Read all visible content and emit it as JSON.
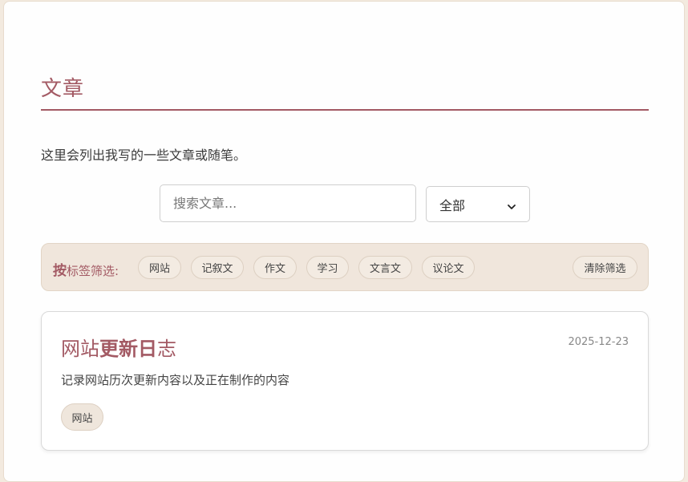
{
  "page": {
    "title": "文章",
    "intro": "这里会列出我写的一些文章或随笔。"
  },
  "search": {
    "placeholder": "搜索文章...",
    "value": ""
  },
  "filter_select": {
    "selected": "全部",
    "options": [
      "全部"
    ]
  },
  "tags": {
    "label_bold": "按",
    "label_rest": "标签筛选:",
    "items": [
      {
        "label": "网站"
      },
      {
        "label": "记叙文"
      },
      {
        "label": "作文"
      },
      {
        "label": "学习"
      },
      {
        "label": "文言文"
      },
      {
        "label": "议论文"
      }
    ],
    "clear_label": "清除筛选"
  },
  "articles": [
    {
      "title_part1": "网站",
      "title_part2": "更新日",
      "title_part3": "志",
      "date": "2025-12-23",
      "description": "记录网站历次更新内容以及正在制作的内容",
      "tag": "网站"
    }
  ],
  "icons": {
    "select_chevron": "chevron-down-icon"
  },
  "colors": {
    "accent": "#a35a64",
    "page_bg": "#f3eadf",
    "tag_bar_bg": "#f0e6dc"
  }
}
